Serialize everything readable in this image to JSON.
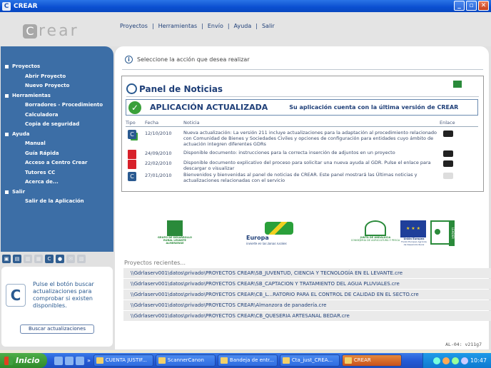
{
  "window": {
    "title": "CREAR",
    "min": "_",
    "max": "▫",
    "close": "✕"
  },
  "brand": {
    "c": "C",
    "rest": "rear"
  },
  "nav": [
    "Proyectos",
    "Herramientas",
    "Envío",
    "Ayuda",
    "Salir"
  ],
  "sidebar": {
    "proyectos": "Proyectos",
    "abrir": "Abrir Proyecto",
    "nuevo": "Nuevo Proyecto",
    "herramientas": "Herramientas",
    "borradores": "Borradores - Procedimiento",
    "calculadora": "Calculadora",
    "copia": "Copia de seguridad",
    "ayuda": "Ayuda",
    "manual": "Manual",
    "guia": "Guía Rápida",
    "acceso": "Acceso a Centro Crear",
    "tutores": "Tutores CC",
    "acerca": "Acerca de...",
    "salir": "Salir",
    "salir_app": "Salir de la Aplicación"
  },
  "update": {
    "message": "Pulse el botón buscar actualizaciones para comprobar si existen disponibles.",
    "button": "Buscar actualizaciones"
  },
  "main": {
    "instruction": "Seleccione la acción que desea realizar"
  },
  "news": {
    "title": "Panel de Noticias",
    "updated_title": "APLICACIÓN ACTUALIZADA",
    "updated_sub": "Su aplicación cuenta con la última versión de CREAR",
    "cols": {
      "tipo": "Tipo",
      "fecha": "Fecha",
      "noticia": "Noticia",
      "enlace": "Enlace"
    },
    "rows": [
      {
        "date": "12/10/2010",
        "text": "Nueva actualización: La versión 211 incluye actualizaciones para la adaptación al procedimiento relacionado con Comunidad de Bienes y Sociedades Civiles y opciones de configuración para entidades cuyo ámbito de actuación integren diferentes GDRs"
      },
      {
        "date": "24/09/2010",
        "text": "Disponible documento: instrucciones para la correcta inserción de adjuntos en un proyecto"
      },
      {
        "date": "22/02/2010",
        "text": "Disponible documento explicativo del proceso para solicitar una nueva ayuda al GDR. Pulse el enlace para descargar o visualizar"
      },
      {
        "date": "27/01/2010",
        "text": "Bienvenidos y bienvenidas al panel de noticias de CREAR. Este panel mostrará las Últimas noticias y actualizaciones relacionadas con el servicio"
      }
    ]
  },
  "logos": {
    "gdr": "GRUPO DE DESARROLLO RURAL LEVANTE ALMERIENSE",
    "europa": "Europa",
    "europa_sub": "invierte en las zonas rurales",
    "junta": "JUNTA DE ANDALUCIA",
    "junta_sub": "CONSEJERÍA DE AGRICULTURA Y PESCA",
    "ue": "Unión Europea",
    "ue_sub": "Fondo Europeo Agrícola de Desarrollo Rural",
    "leader": "LEADER"
  },
  "recent": {
    "title": "Proyectos recientes...",
    "items": [
      "\\\\Gdrlaserv001\\datos\\privado\\PROYECTOS CREAR\\SB_JUVENTUD, CIENCIA Y TECNOLOGÍA EN EL LEVANTE.cre",
      "\\\\Gdrlaserv001\\datos\\privado\\PROYECTOS CREAR\\SB_CAPTACION Y TRATAMIENTO DEL AGUA PLUVIALES.cre",
      "\\\\Gdrlaserv001\\datos\\privado\\PROYECTOS CREAR\\CB_L...RATORIO PARA EL CONTROL DE CALIDAD EN EL SECTO.cre",
      "\\\\Gdrlaserv001\\datos\\privado\\PROYECTOS CREAR\\Almanzora de panadería.cre",
      "\\\\Gdrlaserv001\\datos\\privado\\PROYECTOS CREAR\\CB_QUESERIA ARTESANAL BEDAR.cre"
    ]
  },
  "version": "AL-04: v211g7",
  "taskbar": {
    "start": "Inicio",
    "chevron": "»",
    "buttons": [
      "CUENTA JUSTIF...",
      "ScannerCanon",
      "Bandeja de entr...",
      "Cta_just_CREA...",
      "CREAR"
    ],
    "clock": "10:47"
  }
}
